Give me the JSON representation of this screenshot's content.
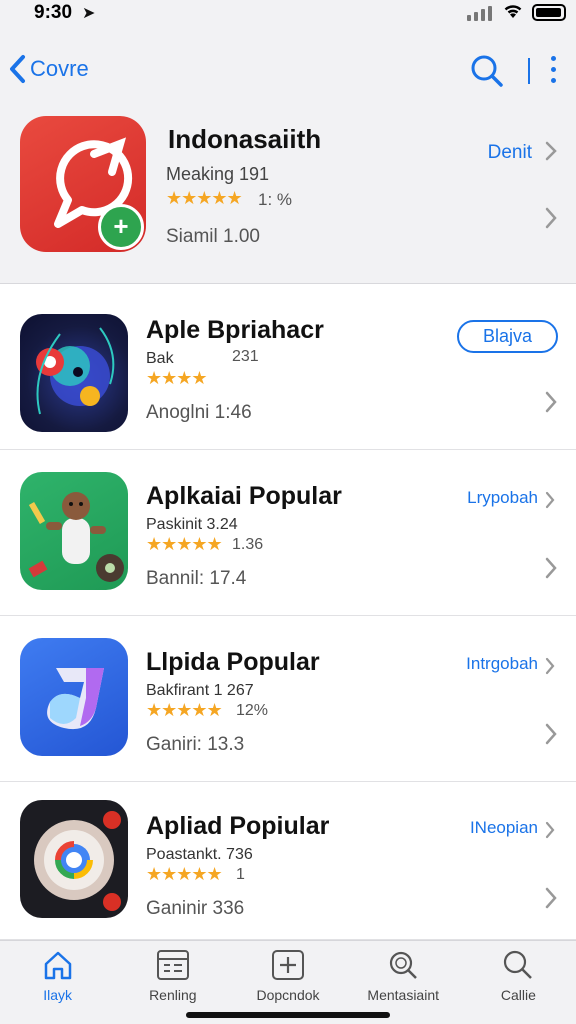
{
  "status": {
    "time": "9:30"
  },
  "nav": {
    "back_label": "Covre"
  },
  "featured": {
    "title": "Indonasaiith",
    "subtitle": "Meaking 191",
    "rating": "1: %",
    "size": "Siamil 1.00",
    "action": "Denit"
  },
  "apps": [
    {
      "name": "Aple Bpriahacr",
      "category": "Bak",
      "rating": "231",
      "size": "Anoglni 1:46",
      "action": "Blajva"
    },
    {
      "name": "Aplkaiai Popular",
      "category": "Paskinit 3.24",
      "rating": "1.36",
      "size": "Bannil: 17.4",
      "action": "Lrypobah"
    },
    {
      "name": "Llpida Popular",
      "category": "Bakfirant 1 267",
      "rating": "12%",
      "size": "Ganiri: 13.3",
      "action": "Intrgobah"
    },
    {
      "name": "Apliad Popiular",
      "category": "Poastankt. 736",
      "rating": "1",
      "size": "Ganinir 336",
      "action": "INeopian"
    }
  ],
  "tabs": [
    {
      "label": "Ilayk",
      "icon": "home-icon"
    },
    {
      "label": "Renling",
      "icon": "calendar-icon"
    },
    {
      "label": "Dopcndok",
      "icon": "plus-box-icon"
    },
    {
      "label": "Mentasiaint",
      "icon": "zoom-icon"
    },
    {
      "label": "Callie",
      "icon": "search-icon"
    }
  ],
  "colors": {
    "accent": "#1a73e8",
    "star": "#f5a623"
  }
}
